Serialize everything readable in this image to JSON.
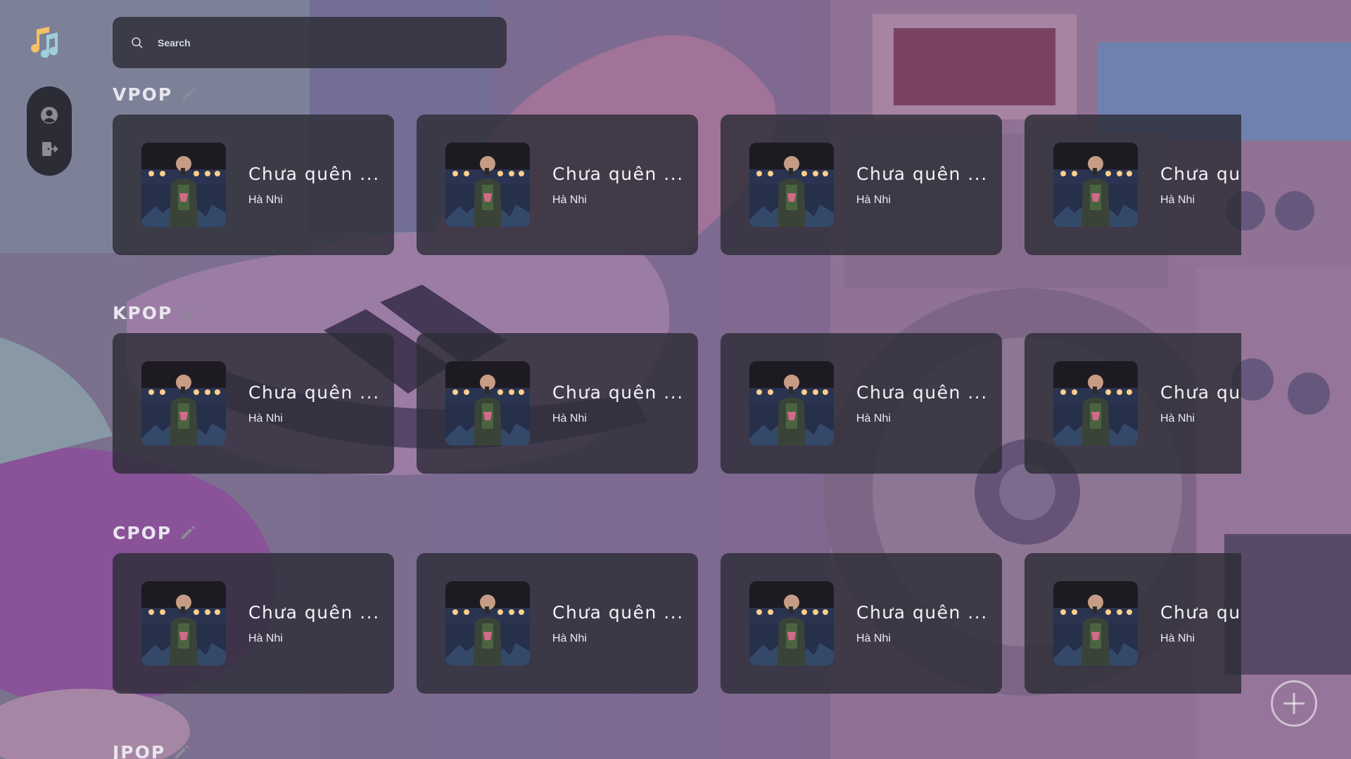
{
  "app": {
    "logo_icon": "music-note-icon",
    "accent_color": "#f4c264"
  },
  "sidebar": {
    "items": [
      {
        "icon": "account-circle-icon"
      },
      {
        "icon": "logout-icon"
      }
    ]
  },
  "search": {
    "placeholder": "Search",
    "icon": "search-icon"
  },
  "sections": [
    {
      "title": "VPOP",
      "cards": [
        {
          "title": "Chưa quên ...",
          "artist": "Hà Nhi"
        },
        {
          "title": "Chưa quên ...",
          "artist": "Hà Nhi"
        },
        {
          "title": "Chưa quên ...",
          "artist": "Hà Nhi"
        },
        {
          "title": "Chưa quên ...",
          "artist": "Hà Nhi"
        }
      ]
    },
    {
      "title": "KPOP",
      "cards": [
        {
          "title": "Chưa quên ...",
          "artist": "Hà Nhi"
        },
        {
          "title": "Chưa quên ...",
          "artist": "Hà Nhi"
        },
        {
          "title": "Chưa quên ...",
          "artist": "Hà Nhi"
        },
        {
          "title": "Chưa quên ...",
          "artist": "Hà Nhi"
        }
      ]
    },
    {
      "title": "CPOP",
      "cards": [
        {
          "title": "Chưa quên ...",
          "artist": "Hà Nhi"
        },
        {
          "title": "Chưa quên ...",
          "artist": "Hà Nhi"
        },
        {
          "title": "Chưa quên ...",
          "artist": "Hà Nhi"
        },
        {
          "title": "Chưa quên ...",
          "artist": "Hà Nhi"
        }
      ]
    },
    {
      "title": "JPOP",
      "cards": []
    }
  ],
  "fab": {
    "icon": "plus-icon"
  }
}
